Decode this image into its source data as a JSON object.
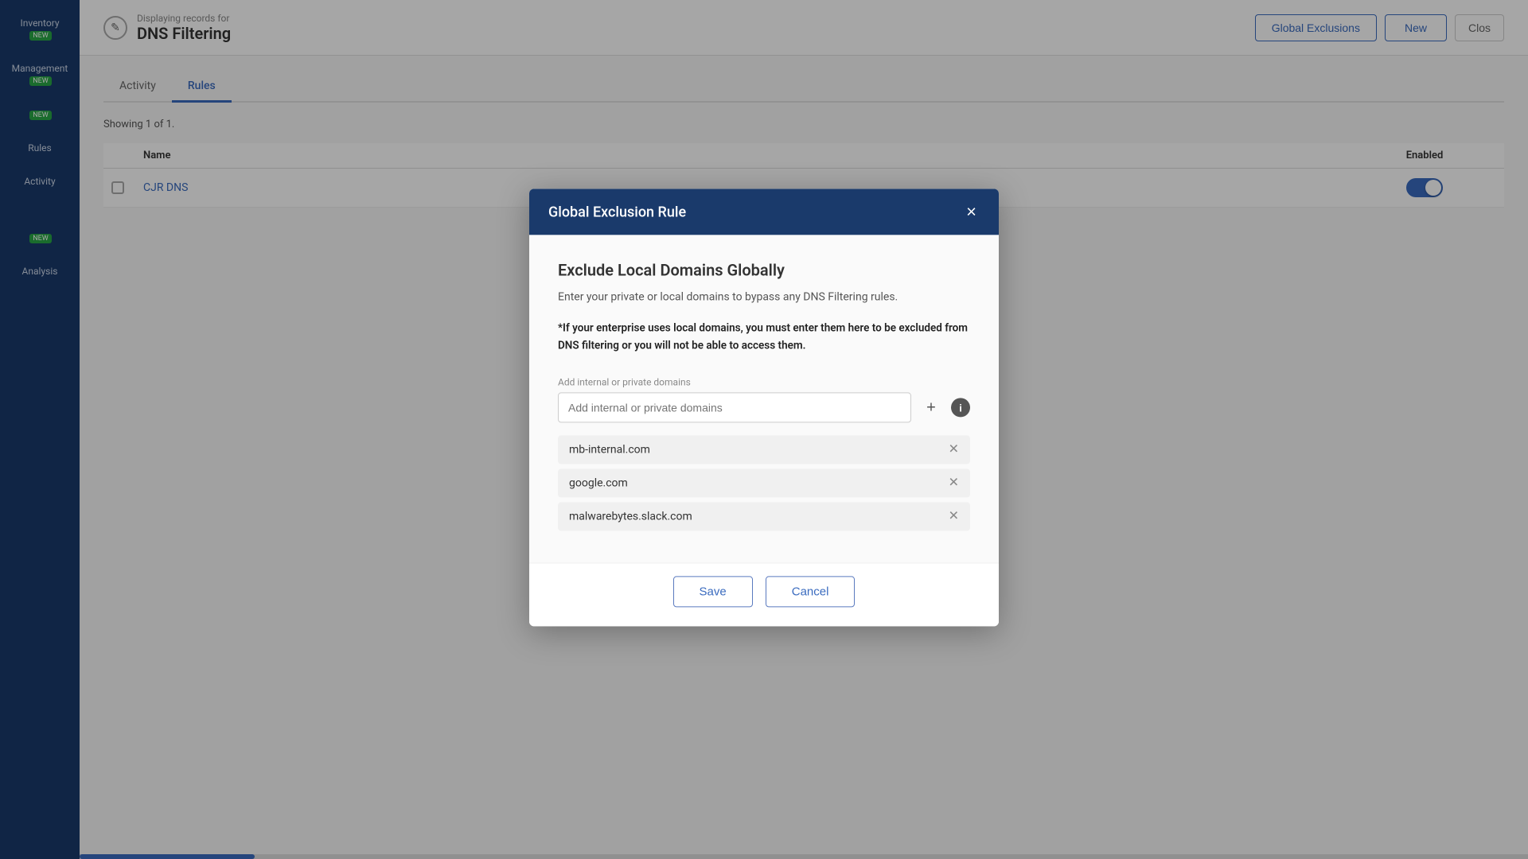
{
  "topbar": {
    "subtitle": "Displaying records for",
    "title": "DNS Filtering",
    "btn_global_exclusions": "Global Exclusions",
    "btn_new": "New",
    "btn_close": "Clos"
  },
  "tabs": [
    {
      "label": "Activity",
      "active": false
    },
    {
      "label": "Rules",
      "active": true
    }
  ],
  "table": {
    "showing_text": "Showing 1 of 1.",
    "columns": {
      "name": "Name",
      "enabled": "Enabled"
    },
    "rows": [
      {
        "name": "CJR DNS",
        "enabled": true
      }
    ]
  },
  "sidebar": {
    "items": [
      {
        "label": "Inventory",
        "badge": "NEW"
      },
      {
        "label": "Management",
        "badge": "NEW"
      },
      {
        "label": "",
        "badge": "NEW"
      },
      {
        "label": "Rules"
      },
      {
        "label": "Activity"
      },
      {
        "label": ""
      },
      {
        "label": "",
        "badge": "NEW"
      },
      {
        "label": "Analysis"
      }
    ]
  },
  "modal": {
    "title": "Global Exclusion Rule",
    "section_title": "Exclude Local Domains Globally",
    "description": "Enter your private or local domains to bypass any DNS Filtering rules.",
    "warning": "*If your enterprise uses local domains, you must enter them here to be excluded from DNS filtering or you will not be able to access them.",
    "input_placeholder": "Add internal or private domains",
    "add_btn_label": "+",
    "info_btn_label": "i",
    "domains": [
      {
        "value": "mb-internal.com"
      },
      {
        "value": "google.com"
      },
      {
        "value": "malwarebytes.slack.com"
      }
    ],
    "btn_save": "Save",
    "btn_cancel": "Cancel"
  }
}
